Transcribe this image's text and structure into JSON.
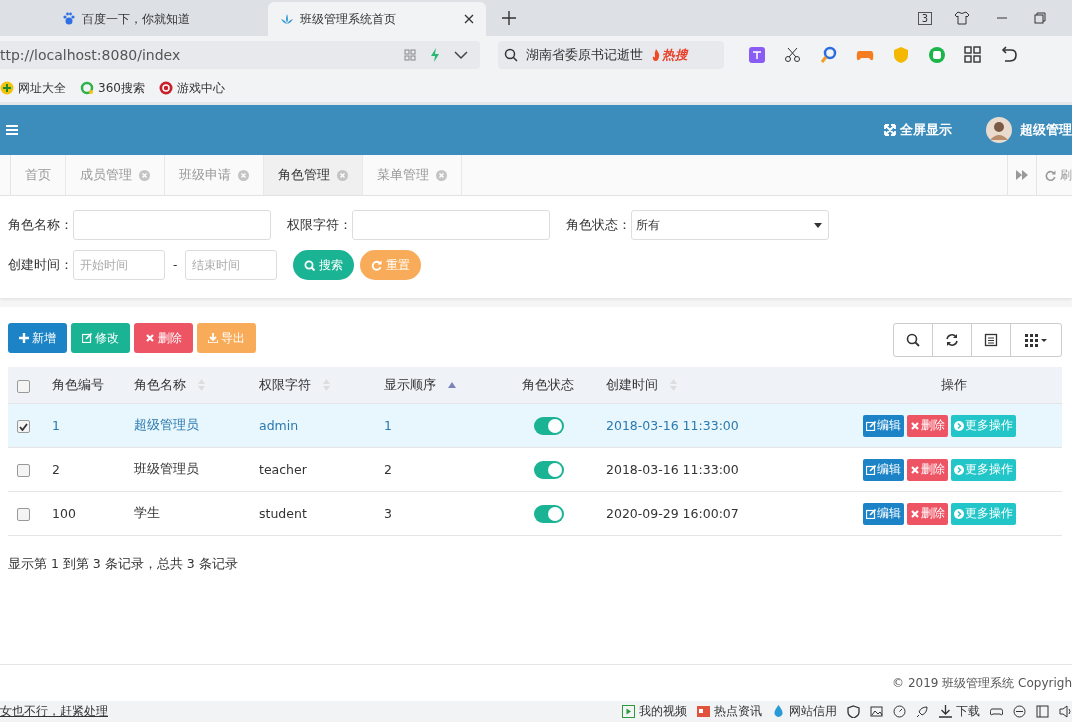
{
  "browser": {
    "tabs": [
      {
        "title": "百度一下，你就知道",
        "selected": false
      },
      {
        "title": "班级管理系统首页",
        "selected": true
      }
    ],
    "tab_count": "3",
    "address": "ttp://localhost:8080/index",
    "search": "湖南省委原书记逝世",
    "hot_label": "热搜",
    "bookmarks": [
      "网址大全",
      "360搜索",
      "游戏中心"
    ]
  },
  "header": {
    "fullscreen": "全屏显示",
    "user": "超级管理"
  },
  "page_tabs": [
    {
      "label": "首页",
      "selected": false,
      "closable": false
    },
    {
      "label": "成员管理",
      "selected": false,
      "closable": true
    },
    {
      "label": "班级申请",
      "selected": false,
      "closable": true
    },
    {
      "label": "角色管理",
      "selected": true,
      "closable": true
    },
    {
      "label": "菜单管理",
      "selected": false,
      "closable": true
    }
  ],
  "refresh_label": "刷",
  "filters": [
    {
      "label": "角色名称：",
      "kind": "text"
    },
    {
      "label": "权限字符：",
      "kind": "text"
    },
    {
      "label": "角色状态：",
      "kind": "select",
      "value": "所有"
    },
    {
      "label": "创建时间：",
      "kind": "range",
      "from_placeholder": "开始时间",
      "separator": "-",
      "to_placeholder": "结束时间"
    }
  ],
  "form_buttons": [
    {
      "label": "搜索",
      "kind": "search"
    },
    {
      "label": "重置",
      "kind": "reset"
    }
  ],
  "toolbar": [
    {
      "label": "新增",
      "kind": "add"
    },
    {
      "label": "修改",
      "kind": "edit"
    },
    {
      "label": "删除",
      "kind": "delete"
    },
    {
      "label": "导出",
      "kind": "export"
    }
  ],
  "table": {
    "all_selected": false,
    "columns": [
      {
        "label": "角色编号",
        "sortable": false,
        "sorted_ascending": false
      },
      {
        "label": "角色名称",
        "sortable": true,
        "sorted_ascending": false
      },
      {
        "label": "权限字符",
        "sortable": true,
        "sorted_ascending": false
      },
      {
        "label": "显示顺序",
        "sortable": true,
        "sorted_ascending": true
      },
      {
        "label": "角色状态",
        "sortable": false,
        "sorted_ascending": false
      },
      {
        "label": "创建时间",
        "sortable": true,
        "sorted_ascending": false
      },
      {
        "label": "操作",
        "sortable": false,
        "sorted_ascending": false
      }
    ],
    "rows": [
      {
        "selected": true,
        "id": "1",
        "name": "超级管理员",
        "key": "admin",
        "order": "1",
        "on": true,
        "created": "2018-03-16 11:33:00",
        "actions": [
          {
            "label": "编辑",
            "kind": "edit"
          },
          {
            "label": "删除",
            "kind": "delete"
          },
          {
            "label": "更多操作",
            "kind": "more"
          }
        ]
      },
      {
        "selected": false,
        "id": "2",
        "name": "班级管理员",
        "key": "teacher",
        "order": "2",
        "on": true,
        "created": "2018-03-16 11:33:00",
        "actions": [
          {
            "label": "编辑",
            "kind": "edit"
          },
          {
            "label": "删除",
            "kind": "delete"
          },
          {
            "label": "更多操作",
            "kind": "more"
          }
        ]
      },
      {
        "selected": false,
        "id": "100",
        "name": "学生",
        "key": "student",
        "order": "3",
        "on": true,
        "created": "2020-09-29 16:00:07",
        "actions": [
          {
            "label": "编辑",
            "kind": "edit"
          },
          {
            "label": "删除",
            "kind": "delete"
          },
          {
            "label": "更多操作",
            "kind": "more"
          }
        ]
      }
    ],
    "summary": "显示第 1 到第 3 条记录，总共 3 条记录"
  },
  "footer": "© 2019 班级管理系统 Copyrigh",
  "status_bar": {
    "message": "女也不行，赶紧处理",
    "items": [
      "我的视频",
      "热点资讯",
      "网站信用",
      "下载"
    ]
  }
}
